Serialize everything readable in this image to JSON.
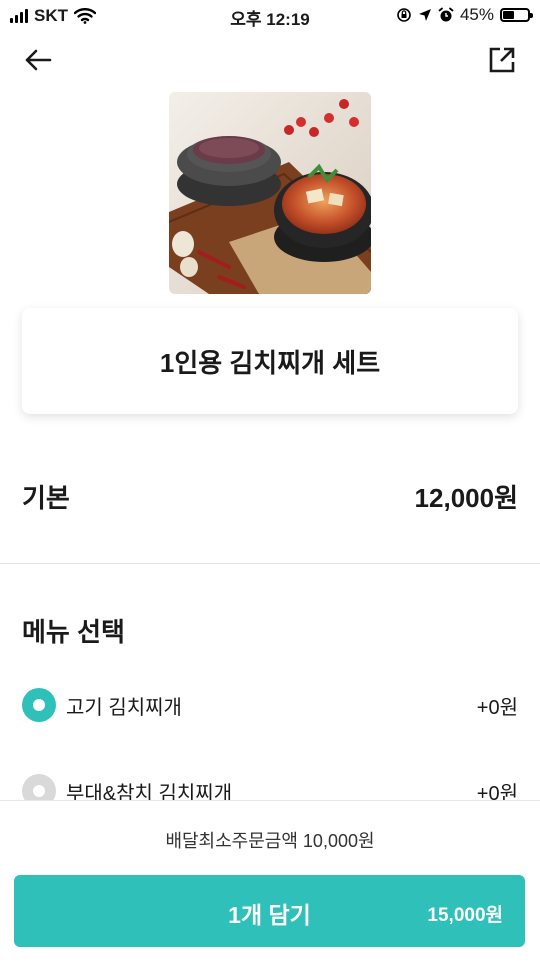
{
  "status_bar": {
    "carrier": "SKT",
    "time": "오후 12:19",
    "battery_percent_label": "45%",
    "battery_level": 0.45
  },
  "nav": {
    "back_icon": "arrow-left-icon",
    "share_icon": "external-share-icon"
  },
  "product": {
    "image_icon": "kimchi-stew-photo",
    "title": "1인용 김치찌개 세트"
  },
  "base": {
    "label": "기본",
    "price": "12,000원"
  },
  "menu_section": {
    "title": "메뉴 선택",
    "options": [
      {
        "label": "고기 김치찌개",
        "price": "+0원",
        "selected": true
      },
      {
        "label": "부대&참치 김치찌개",
        "price": "+0원",
        "selected": false
      }
    ]
  },
  "footer": {
    "min_order": "배달최소주문금액 10,000원",
    "add_button_label": "1개 담기",
    "add_button_price": "15,000원"
  },
  "colors": {
    "accent": "#2ec0b9",
    "radio_unselected": "#d9d9d9"
  }
}
